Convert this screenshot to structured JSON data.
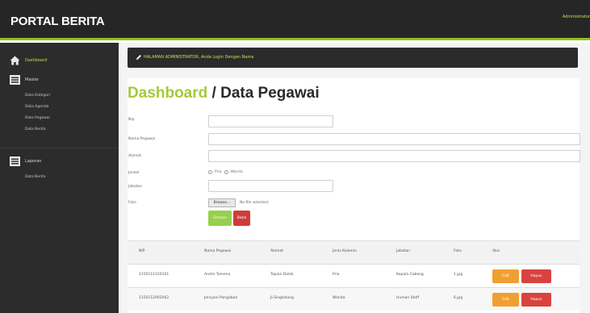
{
  "header": {
    "brand": "PORTAL BERITA",
    "user": "Administrator"
  },
  "sidebar": {
    "dashboard": "Dashboard",
    "master": "Master",
    "master_items": [
      "Data Kategori",
      "Data Agenda",
      "Data Pegawai",
      "Data Berita"
    ],
    "laporan": "Laporan",
    "laporan_items": [
      "Data Berita"
    ]
  },
  "alert": {
    "text": "HALAMAN ADMINISTRATOR, Anda Login Dengan Nama"
  },
  "page": {
    "crumb_link": "Dashboard",
    "crumb_sep": " / ",
    "title": "Data Pegawai"
  },
  "form": {
    "labels": [
      "Nip",
      "Nama Pegawai",
      "Alamat",
      "Jenkel",
      "Jabatan",
      "Foto"
    ],
    "nip_value": "",
    "nama_value": "",
    "alamat_value": "",
    "jabatan_value": "",
    "radio_pria": "Pria",
    "radio_wanita": "Wanita",
    "browse_label": "Browse...",
    "file_status": "No file selected.",
    "simpan_label": "Simpan",
    "batal_label": "Batal"
  },
  "table": {
    "headers": [
      "NIP",
      "Nama Pegawai",
      "Alamat",
      "Jenis Kelamin",
      "Jabatan",
      "Foto",
      "Aksi"
    ],
    "rows": [
      [
        "1150111120101",
        "Andre Tomena",
        "Tapian Dolok",
        "Pria",
        "Kepala Cabang",
        "1.jpg"
      ],
      [
        "1150112002002",
        "Jeniyani Pangaban",
        "Jl.Singkalang",
        "Wanita",
        "Human Staff",
        "6.jpg"
      ]
    ],
    "edit_label": "Edit",
    "delete_label": "Hapus"
  },
  "colors": {
    "accent_green": "#8dc21f",
    "title_green": "#a8c83a",
    "button_orange": "#f0a030",
    "button_red": "#d9433f"
  }
}
